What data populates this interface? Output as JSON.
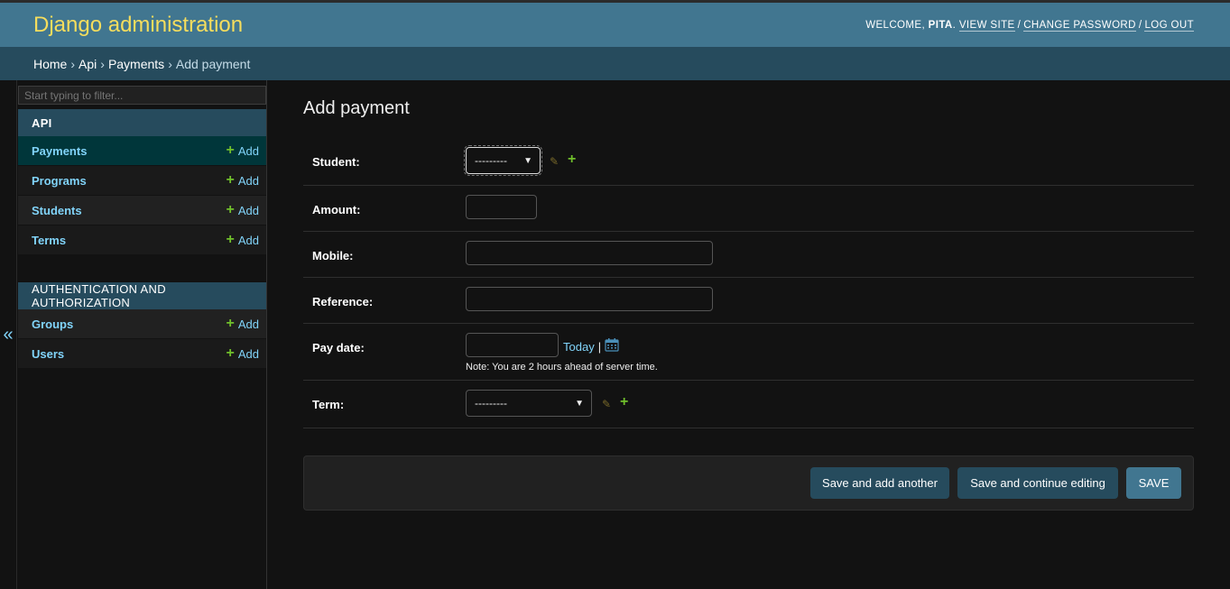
{
  "header": {
    "site_name": "Django administration",
    "welcome": "WELCOME,",
    "username": "PITA",
    "view_site": "VIEW SITE",
    "change_password": "CHANGE PASSWORD",
    "log_out": "LOG OUT"
  },
  "breadcrumbs": {
    "home": "Home",
    "app": "Api",
    "model": "Payments",
    "current": "Add payment",
    "separator": "›"
  },
  "sidebar": {
    "toggle": "«",
    "filter_placeholder": "Start typing to filter...",
    "modules": [
      {
        "caption": "API",
        "models": [
          {
            "name": "Payments",
            "add": "Add",
            "current": true
          },
          {
            "name": "Programs",
            "add": "Add"
          },
          {
            "name": "Students",
            "add": "Add"
          },
          {
            "name": "Terms",
            "add": "Add"
          }
        ]
      },
      {
        "caption": "AUTHENTICATION AND AUTHORIZATION",
        "models": [
          {
            "name": "Groups",
            "add": "Add"
          },
          {
            "name": "Users",
            "add": "Add"
          }
        ]
      }
    ],
    "add_icon": "plus-icon"
  },
  "form": {
    "title": "Add payment",
    "fields": {
      "student": {
        "label": "Student:",
        "selected": "---------"
      },
      "amount": {
        "label": "Amount:",
        "value": ""
      },
      "mobile": {
        "label": "Mobile:",
        "value": ""
      },
      "reference": {
        "label": "Reference:",
        "value": ""
      },
      "pay_date": {
        "label": "Pay date:",
        "value": "",
        "today": "Today",
        "pipe": "|",
        "note": "Note: You are 2 hours ahead of server time."
      },
      "term": {
        "label": "Term:",
        "selected": "---------"
      }
    },
    "buttons": {
      "save_add_another": "Save and add another",
      "save_continue": "Save and continue editing",
      "save": "SAVE"
    }
  },
  "colors": {
    "header_bg": "#417690",
    "site_name": "#f5dd5d",
    "breadcrumbs_bg": "#264b5d",
    "link": "#81d4fa",
    "add_plus": "#70bf2b",
    "page_bg": "#121212"
  }
}
